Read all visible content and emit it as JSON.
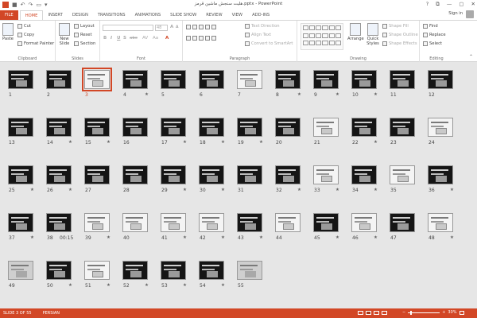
{
  "window": {
    "title": "هلیت سنجش ماشین قرمز.pptx - PowerPoint",
    "quick_access": [
      "save-icon",
      "undo-icon",
      "redo-icon",
      "slideshow-start-icon",
      "customize-icon"
    ],
    "controls": {
      "help": "?",
      "restore": "⧉",
      "minimize": "—",
      "maximize": "▢",
      "close": "✕"
    }
  },
  "tabs": [
    "FILE",
    "HOME",
    "INSERT",
    "DESIGN",
    "TRANSITIONS",
    "ANIMATIONS",
    "SLIDE SHOW",
    "REVIEW",
    "VIEW",
    "ADD-INS"
  ],
  "active_tab": "HOME",
  "account": {
    "sign_in": "Sign in"
  },
  "ribbon": {
    "clipboard": {
      "label": "Clipboard",
      "paste": "Paste",
      "cut": "Cut",
      "copy": "Copy",
      "format_painter": "Format Painter"
    },
    "slides": {
      "label": "Slides",
      "new_slide": "New Slide",
      "layout": "Layout",
      "reset": "Reset",
      "section": "Section"
    },
    "font": {
      "label": "Font",
      "font_size": "48",
      "bold": "B",
      "italic": "I",
      "underline": "U",
      "strike": "S",
      "shadow": "abc",
      "spacing": "AV",
      "case": "Aa",
      "grow": "A",
      "shrink": "A",
      "clear": "A"
    },
    "paragraph": {
      "label": "Paragraph",
      "text_direction": "Text Direction",
      "align_text": "Align Text",
      "convert": "Convert to SmartArt"
    },
    "drawing": {
      "label": "Drawing",
      "arrange": "Arrange",
      "quick_styles": "Quick Styles",
      "shape_fill": "Shape Fill",
      "shape_outline": "Shape Outline",
      "shape_effects": "Shape Effects"
    },
    "editing": {
      "label": "Editing",
      "find": "Find",
      "replace": "Replace",
      "select": "Select"
    }
  },
  "slides": [
    {
      "n": "1",
      "star": false,
      "style": "dark"
    },
    {
      "n": "2",
      "star": false,
      "style": "dark"
    },
    {
      "n": "3",
      "star": false,
      "style": "light",
      "selected": true
    },
    {
      "n": "4",
      "star": true,
      "style": "dark"
    },
    {
      "n": "5",
      "star": false,
      "style": "dark"
    },
    {
      "n": "6",
      "star": false,
      "style": "dark"
    },
    {
      "n": "7",
      "star": false,
      "style": "light"
    },
    {
      "n": "8",
      "star": true,
      "style": "dark"
    },
    {
      "n": "9",
      "star": true,
      "style": "dark"
    },
    {
      "n": "10",
      "star": true,
      "style": "dark"
    },
    {
      "n": "11",
      "star": false,
      "style": "dark"
    },
    {
      "n": "12",
      "star": false,
      "style": "dark"
    },
    {
      "n": "13",
      "star": false,
      "style": "dark"
    },
    {
      "n": "14",
      "star": true,
      "style": "dark"
    },
    {
      "n": "15",
      "star": true,
      "style": "dark"
    },
    {
      "n": "16",
      "star": false,
      "style": "dark"
    },
    {
      "n": "17",
      "star": true,
      "style": "dark"
    },
    {
      "n": "18",
      "star": true,
      "style": "dark"
    },
    {
      "n": "19",
      "star": true,
      "style": "dark"
    },
    {
      "n": "20",
      "star": false,
      "style": "dark"
    },
    {
      "n": "21",
      "star": false,
      "style": "light"
    },
    {
      "n": "22",
      "star": true,
      "style": "dark"
    },
    {
      "n": "23",
      "star": false,
      "style": "dark"
    },
    {
      "n": "24",
      "star": false,
      "style": "light"
    },
    {
      "n": "25",
      "star": true,
      "style": "dark"
    },
    {
      "n": "26",
      "star": true,
      "style": "dark"
    },
    {
      "n": "27",
      "star": false,
      "style": "dark"
    },
    {
      "n": "28",
      "star": false,
      "style": "dark"
    },
    {
      "n": "29",
      "star": true,
      "style": "dark"
    },
    {
      "n": "30",
      "star": true,
      "style": "dark"
    },
    {
      "n": "31",
      "star": false,
      "style": "dark"
    },
    {
      "n": "32",
      "star": true,
      "style": "dark"
    },
    {
      "n": "33",
      "star": true,
      "style": "light"
    },
    {
      "n": "34",
      "star": true,
      "style": "dark"
    },
    {
      "n": "35",
      "star": false,
      "style": "light"
    },
    {
      "n": "36",
      "star": true,
      "style": "dark"
    },
    {
      "n": "37",
      "star": true,
      "style": "dark"
    },
    {
      "n": "38",
      "star": false,
      "style": "dark",
      "time": "00:15"
    },
    {
      "n": "39",
      "star": true,
      "style": "light"
    },
    {
      "n": "40",
      "star": false,
      "style": "light"
    },
    {
      "n": "41",
      "star": true,
      "style": "light"
    },
    {
      "n": "42",
      "star": true,
      "style": "light"
    },
    {
      "n": "43",
      "star": true,
      "style": "dark"
    },
    {
      "n": "44",
      "star": false,
      "style": "light"
    },
    {
      "n": "45",
      "star": true,
      "style": "dark"
    },
    {
      "n": "46",
      "star": true,
      "style": "light"
    },
    {
      "n": "47",
      "star": false,
      "style": "dark"
    },
    {
      "n": "48",
      "star": true,
      "style": "light"
    },
    {
      "n": "49",
      "star": false,
      "style": "photo"
    },
    {
      "n": "50",
      "star": true,
      "style": "dark"
    },
    {
      "n": "51",
      "star": true,
      "style": "light"
    },
    {
      "n": "52",
      "star": true,
      "style": "dark"
    },
    {
      "n": "53",
      "star": true,
      "style": "dark"
    },
    {
      "n": "54",
      "star": true,
      "style": "dark"
    },
    {
      "n": "55",
      "star": false,
      "style": "photo"
    }
  ],
  "status": {
    "slide": "SLIDE 3 OF 55",
    "language": "PERSIAN",
    "zoom": "30%",
    "zoom_out": "−",
    "zoom_in": "+"
  },
  "colors": {
    "accent": "#d24726",
    "background": "#e6e6e6"
  }
}
